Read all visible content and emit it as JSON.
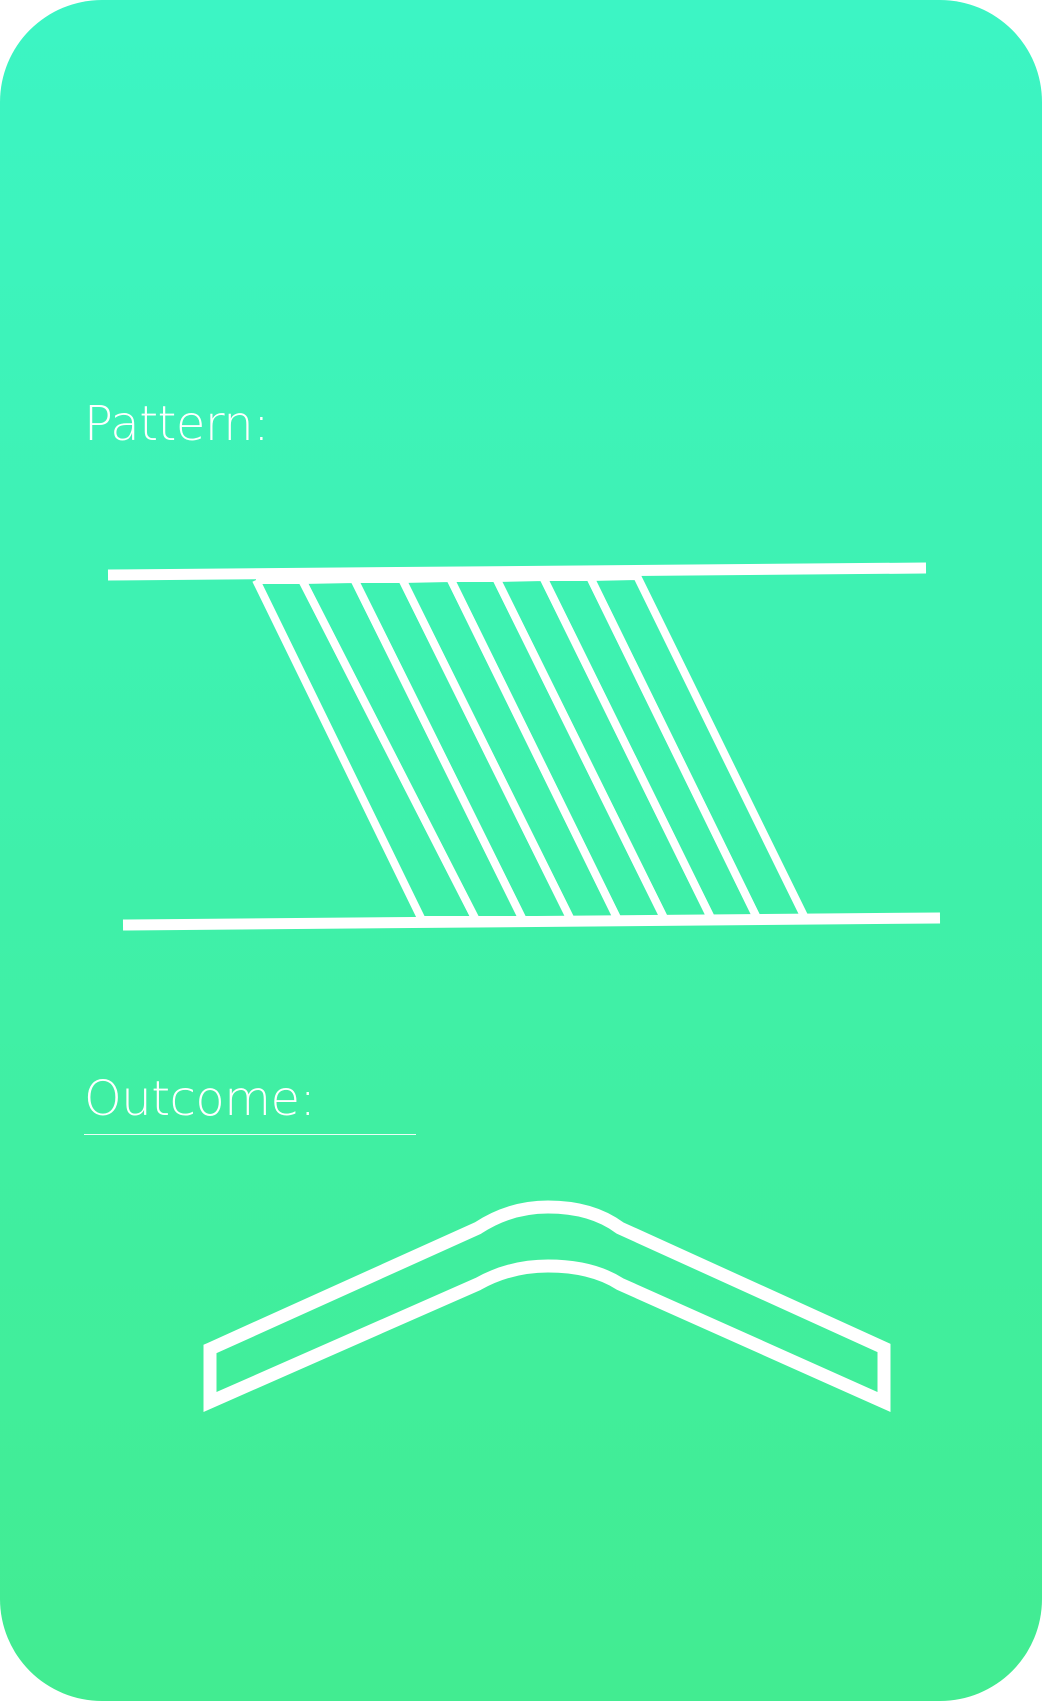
{
  "card": {
    "gradient_top": "#3cf5c4",
    "gradient_bottom": "#42ec91",
    "stroke_color": "#ffffff"
  },
  "pattern": {
    "label": "Pattern:"
  },
  "outcome": {
    "label": "Outcome:"
  }
}
